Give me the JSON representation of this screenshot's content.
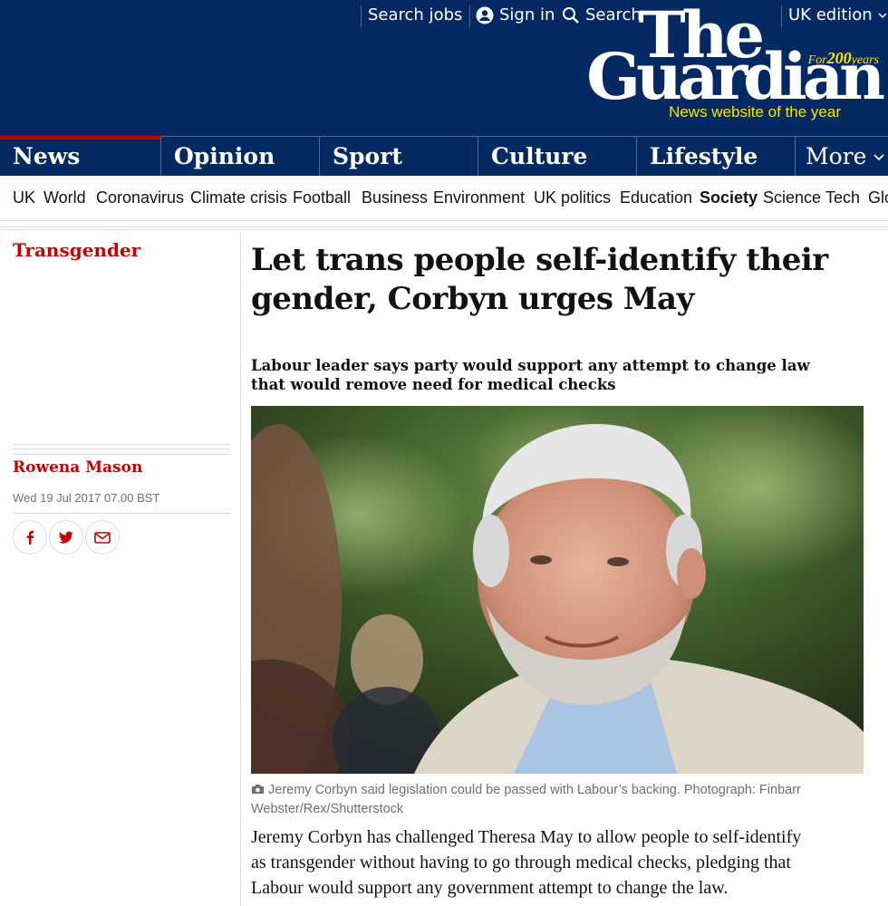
{
  "header": {
    "search_jobs": "Search jobs",
    "sign_in": "Sign in",
    "search": "Search",
    "edition": "UK edition",
    "logo_the": "The",
    "logo_guardian": "Guardian",
    "logo_for": "For",
    "logo_years_num": "200",
    "logo_years": "years",
    "logo_tagline": "News website of the year"
  },
  "pillars": [
    "News",
    "Opinion",
    "Sport",
    "Culture",
    "Lifestyle",
    "More"
  ],
  "subnav": [
    "UK",
    "World",
    "Coronavirus",
    "Climate crisis",
    "Football",
    "Business",
    "Environment",
    "UK politics",
    "Education",
    "Society",
    "Science",
    "Tech",
    "Glo"
  ],
  "article": {
    "section": "Transgender",
    "headline_line1": "Let trans people self-identify their",
    "headline_line2": "gender, Corbyn urges May",
    "standfirst_line1": "Labour leader says party would support any attempt to change law",
    "standfirst_line2": "that would remove need for medical checks",
    "author": "Rowena Mason",
    "date": "Wed 19 Jul 2017 07.00 BST",
    "caption_line1": "Jeremy Corbyn said legislation could be passed with Labour’s backing. Photograph: Finbarr",
    "caption_line2": "Webster/Rex/Shutterstock",
    "body_line1": "Jeremy Corbyn has challenged Theresa May to allow people to self-identify",
    "body_line2": "as transgender without having to go through medical checks, pledging that",
    "body_line3": "Labour would support any government attempt to change the law."
  },
  "share_icons": [
    "facebook-icon",
    "twitter-icon",
    "email-icon"
  ],
  "colors": {
    "brand": "#052962",
    "accent": "#c70000",
    "logo_yellow": "#ffe500"
  }
}
